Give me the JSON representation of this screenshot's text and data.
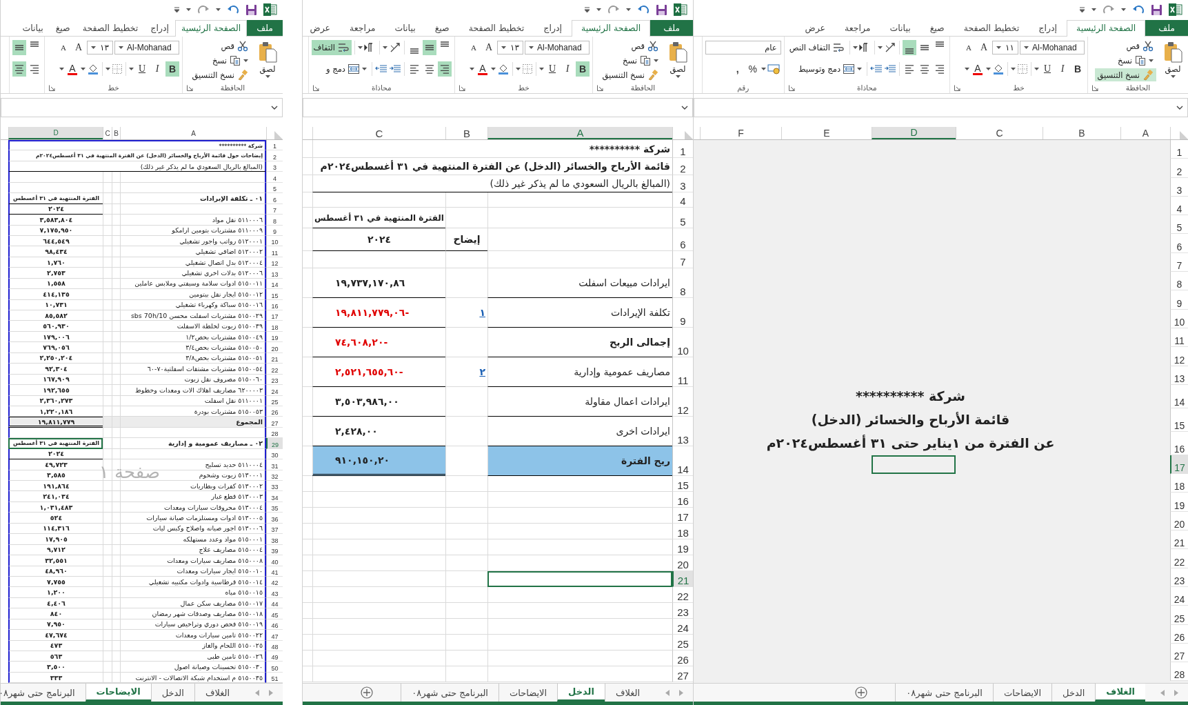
{
  "windows": [
    {
      "print_area_border": false,
      "page_break_preview": true,
      "new_sheet_button": true,
      "tabs": [
        {
          "label": "ملف",
          "kind": "file",
          "selected": false
        },
        {
          "label": "الصفحة الرئيسية",
          "kind": "tab",
          "selected": true
        },
        {
          "label": "إدراج",
          "kind": "tab",
          "selected": false
        },
        {
          "label": "تخطيط الصفحة",
          "kind": "tab",
          "selected": false
        },
        {
          "label": "صيغ",
          "kind": "tab",
          "selected": false
        },
        {
          "label": "بيانات",
          "kind": "tab",
          "selected": false
        },
        {
          "label": "مراجعة",
          "kind": "tab",
          "selected": false
        },
        {
          "label": "عرض",
          "kind": "tab",
          "selected": false
        }
      ],
      "ribbon": {
        "clipboard": {
          "label": "الحافظة",
          "paste": "لصق",
          "cut": "قص",
          "copy": "نسخ",
          "format_painter": "نسخ التنسيق",
          "format_painter_on": true
        },
        "font": {
          "label": "خط",
          "name": "Al-Mohanad",
          "size": "١١",
          "grow": "A",
          "shrink": "A",
          "bold": "B",
          "italic": "I",
          "underline": "U",
          "font_color_label": "A",
          "bold_on": false
        },
        "alignment": {
          "label": "محاذاة",
          "vertical": [
            {
              "selected": false
            },
            {
              "selected": false
            },
            {
              "selected": true
            }
          ],
          "horizontal": [
            {
              "selected": false
            },
            {
              "selected": false
            },
            {
              "selected": false
            }
          ],
          "wrap": {
            "label": "التفاف النص",
            "on": false
          },
          "merge": {
            "label": "دمج وتوسيط"
          }
        },
        "number": {
          "label": "رقم",
          "format": "عام",
          "percent": "%",
          "comma": ","
        }
      },
      "columns": [
        {
          "name": "A",
          "selected": false
        },
        {
          "name": "B",
          "selected": false
        },
        {
          "name": "C",
          "selected": false
        },
        {
          "name": "D",
          "selected": true
        },
        {
          "name": "E",
          "selected": false
        },
        {
          "name": "F",
          "selected": false
        }
      ],
      "rows": [
        {
          "number": "1",
          "selected": false,
          "kind": "blank"
        },
        {
          "number": "2",
          "selected": false,
          "kind": "blank"
        },
        {
          "number": "3",
          "selected": false,
          "kind": "blank"
        },
        {
          "number": "4",
          "selected": false,
          "kind": "blank"
        },
        {
          "number": "5",
          "selected": false,
          "kind": "blank"
        },
        {
          "number": "6",
          "selected": false,
          "kind": "blank"
        },
        {
          "number": "7",
          "selected": false,
          "kind": "blank"
        },
        {
          "number": "8",
          "selected": false,
          "kind": "blank"
        },
        {
          "number": "9",
          "selected": false,
          "kind": "blank"
        },
        {
          "number": "10",
          "selected": false,
          "kind": "blank"
        },
        {
          "number": "11",
          "selected": false,
          "kind": "blank"
        },
        {
          "number": "12",
          "selected": false,
          "kind": "blank"
        },
        {
          "number": "13",
          "selected": false,
          "kind": "blank"
        },
        {
          "number": "14",
          "selected": false,
          "kind": "centered",
          "label": "شركة  **********"
        },
        {
          "number": "15",
          "selected": false,
          "kind": "centered",
          "label": "قائمة الأرباح والخسائر (الدخل)"
        },
        {
          "number": "16",
          "selected": false,
          "kind": "centered",
          "label": "عن الفترة من ١يناير حتى ٣١ أغسطس٢٠٢٤م"
        },
        {
          "number": "17",
          "selected": true,
          "kind": "blank"
        },
        {
          "number": "18",
          "selected": false,
          "kind": "blank"
        },
        {
          "number": "19",
          "selected": false,
          "kind": "blank"
        },
        {
          "number": "20",
          "selected": false,
          "kind": "blank"
        },
        {
          "number": "21",
          "selected": false,
          "kind": "blank"
        },
        {
          "number": "22",
          "selected": false,
          "kind": "blank"
        },
        {
          "number": "23",
          "selected": false,
          "kind": "blank"
        },
        {
          "number": "24",
          "selected": false,
          "kind": "blank"
        },
        {
          "number": "25",
          "selected": false,
          "kind": "blank"
        },
        {
          "number": "26",
          "selected": false,
          "kind": "blank"
        },
        {
          "number": "27",
          "selected": false,
          "kind": "blank"
        },
        {
          "number": "28",
          "selected": false,
          "kind": "blank"
        }
      ],
      "sheets": [
        {
          "label": "الغلاف",
          "selected": true
        },
        {
          "label": "الدخل",
          "selected": false
        },
        {
          "label": "الايضاحات",
          "selected": false
        },
        {
          "label": "البرنامج حتى شهر٠٨",
          "selected": false
        }
      ]
    },
    {
      "print_area_border": false,
      "page_break_preview": false,
      "new_sheet_button": true,
      "tabs": [
        {
          "label": "ملف",
          "kind": "file",
          "selected": false
        },
        {
          "label": "الصفحة الرئيسية",
          "kind": "tab",
          "selected": true
        },
        {
          "label": "إدراج",
          "kind": "tab",
          "selected": false
        },
        {
          "label": "تخطيط الصفحة",
          "kind": "tab",
          "selected": false
        },
        {
          "label": "صيغ",
          "kind": "tab",
          "selected": false
        },
        {
          "label": "بيانات",
          "kind": "tab",
          "selected": false
        },
        {
          "label": "مراجعة",
          "kind": "tab",
          "selected": false
        },
        {
          "label": "عرض",
          "kind": "tab",
          "selected": false
        }
      ],
      "ribbon": {
        "clipboard": {
          "label": "الحافظة",
          "paste": "لصق",
          "cut": "قص",
          "copy": "نسخ",
          "format_painter": "نسخ التنسيق",
          "format_painter_on": false
        },
        "font": {
          "label": "خط",
          "name": "Al-Mohanad",
          "size": "١٣",
          "grow": "A",
          "shrink": "A",
          "bold": "B",
          "italic": "I",
          "underline": "U",
          "font_color_label": "A",
          "bold_on": true
        },
        "alignment": {
          "label": "محاذاة",
          "vertical": [
            {
              "selected": false
            },
            {
              "selected": true
            },
            {
              "selected": false
            }
          ],
          "horizontal": [
            {
              "selected": true
            },
            {
              "selected": false
            },
            {
              "selected": false
            }
          ],
          "wrap": {
            "label": "التفاف",
            "on": true
          },
          "merge": {
            "label": "دمج و"
          }
        }
      },
      "columns": [
        {
          "name": "A",
          "selected": true
        },
        {
          "name": "B",
          "selected": false
        },
        {
          "name": "C",
          "selected": false
        }
      ],
      "rows": [
        {
          "number": "1",
          "selected": false,
          "kind": "title",
          "label": "شركة  **********"
        },
        {
          "number": "2",
          "selected": false,
          "kind": "title",
          "label": "قائمة الأرباح والخسائر (الدخل) عن الفترة المنتهية في ٣١ أغسطس٢٠٢٤م"
        },
        {
          "number": "3",
          "selected": false,
          "kind": "note",
          "label": "(المبالغ بالريال السعودي ما لم يذكر غير ذلك)"
        },
        {
          "number": "4",
          "selected": false,
          "kind": "blank"
        },
        {
          "number": "5",
          "selected": false,
          "kind": "section",
          "value": "الفترة المنتهية في ٣١ أغسطس"
        },
        {
          "number": "6",
          "selected": false,
          "kind": "year",
          "note": "إيضاح",
          "value": "٢٠٢٤"
        },
        {
          "number": "7",
          "selected": false,
          "kind": "blank"
        },
        {
          "number": "8",
          "selected": false,
          "kind": "line",
          "label": "ايرادات مبيعات اسفلت",
          "value": "١٩,٧٣٧,١٧٠,٨٦",
          "negative": false
        },
        {
          "number": "9",
          "selected": false,
          "kind": "line",
          "label": "تكلفة الإيرادات",
          "note": "١",
          "value": "١٩,٨١١,٧٧٩,٠٦-",
          "negative": true
        },
        {
          "number": "10",
          "selected": false,
          "kind": "subtotal",
          "label": "إجمالى الربح",
          "value": "٧٤,٦٠٨,٢٠-",
          "negative": true
        },
        {
          "number": "11",
          "selected": false,
          "kind": "line",
          "label": "مصاريف عمومية وإدارية",
          "note": "٢",
          "value": "٢,٥٢١,٦٥٥,٦٠-",
          "negative": true
        },
        {
          "number": "12",
          "selected": false,
          "kind": "line",
          "label": "ايرادات اعمال مقاولة",
          "value": "٣,٥٠٣,٩٨٦,٠٠",
          "negative": false
        },
        {
          "number": "13",
          "selected": false,
          "kind": "line",
          "label": "ايرادات اخرى",
          "value": "٢,٤٢٨,٠٠",
          "negative": false
        },
        {
          "number": "14",
          "selected": false,
          "kind": "profit",
          "label": "ربح الفترة",
          "value": "٩١٠,١٥٠,٢٠",
          "negative": false
        },
        {
          "number": "15",
          "selected": false,
          "kind": "blank"
        },
        {
          "number": "16",
          "selected": false,
          "kind": "blank"
        },
        {
          "number": "17",
          "selected": false,
          "kind": "blank"
        },
        {
          "number": "18",
          "selected": false,
          "kind": "blank"
        },
        {
          "number": "19",
          "selected": false,
          "kind": "blank"
        },
        {
          "number": "20",
          "selected": false,
          "kind": "blank"
        },
        {
          "number": "21",
          "selected": true,
          "kind": "blank"
        },
        {
          "number": "22",
          "selected": false,
          "kind": "blank"
        },
        {
          "number": "23",
          "selected": false,
          "kind": "blank"
        },
        {
          "number": "24",
          "selected": false,
          "kind": "blank"
        },
        {
          "number": "25",
          "selected": false,
          "kind": "blank"
        },
        {
          "number": "26",
          "selected": false,
          "kind": "blank"
        },
        {
          "number": "27",
          "selected": false,
          "kind": "blank"
        }
      ],
      "sheets": [
        {
          "label": "الغلاف",
          "selected": false
        },
        {
          "label": "الدخل",
          "selected": true
        },
        {
          "label": "الايضاحات",
          "selected": false
        },
        {
          "label": "البرنامج حتى شهر٠٨",
          "selected": false
        }
      ]
    },
    {
      "print_area_border": true,
      "page_break_preview": false,
      "page_label": "صفحة ١",
      "new_sheet_button": false,
      "tabs": [
        {
          "label": "ملف",
          "kind": "file",
          "selected": false
        },
        {
          "label": "الصفحة الرئيسية",
          "kind": "tab",
          "selected": true
        },
        {
          "label": "إدراج",
          "kind": "tab",
          "selected": false
        },
        {
          "label": "تخطيط الصفحة",
          "kind": "tab",
          "selected": false
        },
        {
          "label": "صيغ",
          "kind": "tab",
          "selected": false
        },
        {
          "label": "بيانات",
          "kind": "tab",
          "selected": false
        }
      ],
      "ribbon": {
        "clipboard": {
          "label": "الحافظة",
          "paste": "لصق",
          "cut": "قص",
          "copy": "نسخ",
          "format_painter": "نسخ التنسيق",
          "format_painter_on": false
        },
        "font": {
          "label": "خط",
          "name": "Al-Mohanad",
          "size": "١٣",
          "grow": "A",
          "shrink": "A",
          "bold": "B",
          "italic": "I",
          "underline": "U",
          "font_color_label": "A",
          "bold_on": true
        },
        "alignment": {
          "vertical": [
            {
              "selected": false
            },
            {
              "selected": true
            }
          ],
          "horizontal": [
            {
              "selected": false
            },
            {
              "selected": true
            }
          ]
        }
      },
      "columns": [
        {
          "name": "A",
          "selected": false
        },
        {
          "name": "B",
          "selected": false
        },
        {
          "name": "C",
          "selected": false
        },
        {
          "name": "D",
          "selected": true
        }
      ],
      "rows": [
        {
          "number": "1",
          "selected": false,
          "kind": "title",
          "label": "شركة  **********"
        },
        {
          "number": "2",
          "selected": false,
          "kind": "title",
          "label": "إيضاحات حول قائمة الأرباح والخسائر (الدخل) عن الفترة المنتهية في ٣١ أغسطس٢٠٢٤م"
        },
        {
          "number": "3",
          "selected": false,
          "kind": "note",
          "label": "(المبالغ بالريال السعودي ما لم يذكر غير ذلك)"
        },
        {
          "number": "4",
          "selected": false,
          "kind": "blank"
        },
        {
          "number": "5",
          "selected": false,
          "kind": "blank"
        },
        {
          "number": "6",
          "selected": false,
          "kind": "section",
          "label": "٠١ ـ تكلفة الإيرادات",
          "value": "الفترة المنتهية في ٣١ أغسطس"
        },
        {
          "number": "7",
          "selected": false,
          "kind": "year",
          "value": "٢٠٢٤"
        },
        {
          "number": "8",
          "selected": false,
          "kind": "account",
          "label": "٥١١٠٠٠٦ نقل مواد",
          "value": "٣,٥٨٣,٨٠٤"
        },
        {
          "number": "9",
          "selected": false,
          "kind": "account",
          "label": "٥١١٠٠٠٩ مشتريات بتومين ارامكو",
          "value": "٧,١٧٥,٩٥٠"
        },
        {
          "number": "10",
          "selected": false,
          "kind": "account",
          "label": "٥١٢٠٠٠١ رواتب واجور تشغيلي",
          "value": "٦٤٤,٥٤٩"
        },
        {
          "number": "11",
          "selected": false,
          "kind": "account",
          "label": "٥١٢٠٠٠٢ اضافي تشغيلي",
          "value": "٩٨,٤٣٤"
        },
        {
          "number": "12",
          "selected": false,
          "kind": "account",
          "label": "٥١٢٠٠٠٤ بدل اتصال تشغيلي",
          "value": "١,٧٦٠"
        },
        {
          "number": "13",
          "selected": false,
          "kind": "account",
          "label": "٥١٢٠٠٠٦ بدلات اخرى تشغيلي",
          "value": "٢,٧٥٣"
        },
        {
          "number": "14",
          "selected": false,
          "kind": "account",
          "label": "٥١٥٠٠١١ ادوات سلامة وسيفتي وملابس عاملين",
          "value": "١,٥٥٨"
        },
        {
          "number": "15",
          "selected": false,
          "kind": "account",
          "label": "٥١٥٠٠١٢ ايجار نقل بيتومين",
          "value": "٤١٤,١٣٥"
        },
        {
          "number": "16",
          "selected": false,
          "kind": "account",
          "label": "٥١٥٠٠١٦ سباكة وكهرباء تشغيلي",
          "value": "١٠,٧٣١"
        },
        {
          "number": "17",
          "selected": false,
          "kind": "account",
          "label": "٥١٥٠٠٢٩ مشتريات اسفلت محسن sbs 70h/10",
          "value": "٨٥,٥٨٢"
        },
        {
          "number": "18",
          "selected": false,
          "kind": "account",
          "label": "٥١٥٠٠٣٩ زيوت لخلطة الاسفلت",
          "value": "٥٦٠,٩٣٠"
        },
        {
          "number": "19",
          "selected": false,
          "kind": "account",
          "label": "٥١٥٠٠٤٩ مشتريات بحص١/٢",
          "value": "١٧٩,٠٠٦"
        },
        {
          "number": "20",
          "selected": false,
          "kind": "account",
          "label": "٥١٥٠٠٥٠ مشتريات بحص٣/٤",
          "value": "٧٦٩,٠٥٦"
        },
        {
          "number": "21",
          "selected": false,
          "kind": "account",
          "label": "٥١٥٠٠٥١ مشتريات بحص٣/٨",
          "value": "٢,٢٥٠,٢٠٤"
        },
        {
          "number": "22",
          "selected": false,
          "kind": "account",
          "label": "٥١٥٠٠٥٤ مشتريات مشتقات اسفلتية٧٠-٦٠",
          "value": "٩٢,٣٠٤"
        },
        {
          "number": "23",
          "selected": false,
          "kind": "account",
          "label": "٥١٥٠٠٦٠ مصروف نقل زيوت",
          "value": "١٦٧,٩٠٩"
        },
        {
          "number": "24",
          "selected": false,
          "kind": "account",
          "label": "٦٢٠٠٠٠٣ مصاريف اهلاك الات ومعدات وخطوط",
          "value": "١٩٢,٦٥٥"
        },
        {
          "number": "25",
          "selected": false,
          "kind": "account",
          "label": "٥١١٠٠٠١ نقل اسفلت",
          "value": "٢,٣٦٠,٢٧٣"
        },
        {
          "number": "26",
          "selected": false,
          "kind": "account",
          "label": "٥١٥٠٠٥٣ مشتريات بودرة",
          "value": "١,٢٢٠,١٨٦"
        },
        {
          "number": "27",
          "selected": false,
          "kind": "total",
          "label": "المجموع",
          "value": "١٩,٨١١,٧٧٩"
        },
        {
          "number": "28",
          "selected": false,
          "kind": "blank"
        },
        {
          "number": "29",
          "selected": true,
          "kind": "section",
          "label": "٠٢ ـ مصاريف عمومية و إدارية",
          "value": "الفترة المنتهية في ٣١ أغسطس"
        },
        {
          "number": "30",
          "selected": false,
          "kind": "year",
          "value": "٢٠٢٤"
        },
        {
          "number": "31",
          "selected": false,
          "kind": "account",
          "label": "٥١١٠٠٠٤ حديد تسليح",
          "value": "٤٩,٧٢٣"
        },
        {
          "number": "32",
          "selected": false,
          "kind": "account",
          "label": "٥١٣٠٠٠١ زيوت وشحوم",
          "value": "٣,٥٨٥"
        },
        {
          "number": "33",
          "selected": false,
          "kind": "account",
          "label": "٥١٣٠٠٠٢ كفرات وبطاريات",
          "value": "١٩١,٨٦٤"
        },
        {
          "number": "34",
          "selected": false,
          "kind": "account",
          "label": "٥١٣٠٠٠٣ قطع غيار",
          "value": "٢٤١,٠٣٤"
        },
        {
          "number": "35",
          "selected": false,
          "kind": "account",
          "label": "٥١٣٠٠٠٤ محروقات سيارات ومعدات",
          "value": "١,٠٣١,٤٨٣"
        },
        {
          "number": "36",
          "selected": false,
          "kind": "account",
          "label": "٥١٣٠٠٠٥ ادوات ومستلزمات صيانة سيارات",
          "value": "٥٢٤"
        },
        {
          "number": "37",
          "selected": false,
          "kind": "account",
          "label": "٥١٣٠٠٠٦ اجور صيانه واصلاح  وكبس ليات",
          "value": "١١٤,٣١٦"
        },
        {
          "number": "38",
          "selected": false,
          "kind": "account",
          "label": "٥١٥٠٠٠١ مواد وعدد مستهلكه",
          "value": "١٧,٩٠٥"
        },
        {
          "number": "39",
          "selected": false,
          "kind": "account",
          "label": "٥١٥٠٠٠٤ مصاريف علاج",
          "value": "٩,٧١٢"
        },
        {
          "number": "40",
          "selected": false,
          "kind": "account",
          "label": "٥١٥٠٠٠٨ مصاريف سيارات ومعدات",
          "value": "٣٢,٥٥١"
        },
        {
          "number": "41",
          "selected": false,
          "kind": "account",
          "label": "٥١٥٠٠١٠ ايجار سيارات ومعدات",
          "value": "٤٨,٩٦٠"
        },
        {
          "number": "42",
          "selected": false,
          "kind": "account",
          "label": "٥١٥٠٠١٤ قرطاسية وادوات مكتبيه تشغيلي",
          "value": "٧,٧٥٥"
        },
        {
          "number": "43",
          "selected": false,
          "kind": "account",
          "label": "٥١٥٠٠١٥ مياه",
          "value": "١,٢٠٠"
        },
        {
          "number": "44",
          "selected": false,
          "kind": "account",
          "label": "٥١٥٠٠١٧ مصاريف سكن عمال",
          "value": "٤,٤٠٦"
        },
        {
          "number": "45",
          "selected": false,
          "kind": "account",
          "label": "٥١٥٠٠١٨ مصاريف وصدقات شهر رمضان",
          "value": "٨٤٠"
        },
        {
          "number": "46",
          "selected": false,
          "kind": "account",
          "label": "٥١٥٠٠١٩ فحص دوري وتراخيص سيارات",
          "value": "٧,٩٥٠"
        },
        {
          "number": "47",
          "selected": false,
          "kind": "account",
          "label": "٥١٥٠٠٢٢ تامين سيارات ومعدات",
          "value": "٤٧,٦٧٤"
        },
        {
          "number": "48",
          "selected": false,
          "kind": "account",
          "label": "٥١٥٠٠٢٥ اللحام والغاز",
          "value": "٤٧٣"
        },
        {
          "number": "49",
          "selected": false,
          "kind": "account",
          "label": "٥١٥٠٠٢٦ تامين طبى",
          "value": "٥٦٣"
        },
        {
          "number": "50",
          "selected": false,
          "kind": "account",
          "label": "٥١٥٠٠٣٠ تحسينات وصيانة اصول",
          "value": "٣,٥٠٠"
        },
        {
          "number": "51",
          "selected": false,
          "kind": "account",
          "label": "٥١٥٠٠٣٥ م استخدام شبكة الاتصالات - الانترنت",
          "value": "٣٣٣"
        }
      ],
      "sheets": [
        {
          "label": "الغلاف",
          "selected": false
        },
        {
          "label": "الدخل",
          "selected": false
        },
        {
          "label": "الايضاحات",
          "selected": true
        },
        {
          "label": "البرنامج حتى شهر٠٨",
          "selected": false
        }
      ]
    }
  ]
}
